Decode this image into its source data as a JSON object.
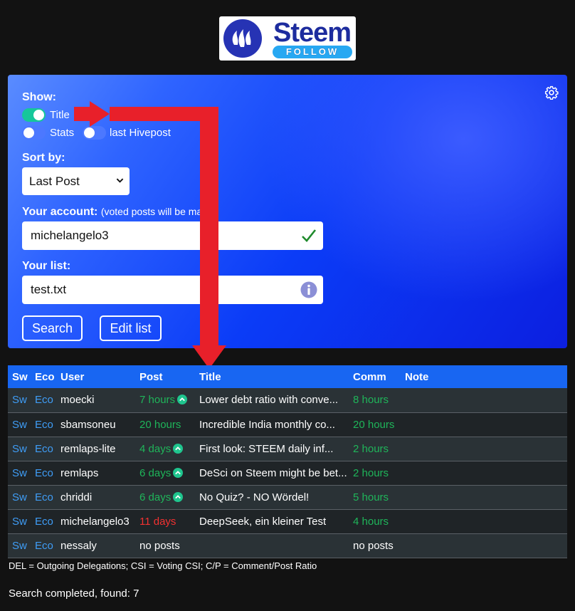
{
  "logo": {
    "word": "Steem",
    "sub": "FOLLOW"
  },
  "show": {
    "label": "Show:",
    "options": [
      {
        "label": "Title",
        "on": true
      },
      {
        "label": "Stats",
        "on": false
      },
      {
        "label": "last Hivepost",
        "on": false
      }
    ]
  },
  "sort": {
    "label": "Sort by:",
    "value": "Last Post"
  },
  "account": {
    "label": "Your account:",
    "note": "(voted posts will be mark",
    "value": "michelangelo3"
  },
  "list": {
    "label": "Your list:",
    "value": "test.txt"
  },
  "buttons": {
    "search": "Search",
    "edit": "Edit list"
  },
  "table": {
    "headers": [
      "Sw",
      "Eco",
      "User",
      "Post",
      "Title",
      "Comm",
      "Note"
    ],
    "rows": [
      {
        "sw": "Sw",
        "eco": "Eco",
        "user": "moecki",
        "post": "7 hours",
        "post_color": "green",
        "voted": true,
        "title": "Lower debt ratio with conve...",
        "comm": "8 hours",
        "note": ""
      },
      {
        "sw": "Sw",
        "eco": "Eco",
        "user": "sbamsoneu",
        "post": "20 hours",
        "post_color": "green",
        "voted": false,
        "title": "Incredible India monthly co...",
        "comm": "20 hours",
        "note": ""
      },
      {
        "sw": "Sw",
        "eco": "Eco",
        "user": "remlaps-lite",
        "post": "4 days",
        "post_color": "green",
        "voted": true,
        "title": "First look: STEEM daily inf...",
        "comm": "2 hours",
        "note": ""
      },
      {
        "sw": "Sw",
        "eco": "Eco",
        "user": "remlaps",
        "post": "6 days",
        "post_color": "green",
        "voted": true,
        "title": "DeSci on Steem might be bet...",
        "comm": "2 hours",
        "note": ""
      },
      {
        "sw": "Sw",
        "eco": "Eco",
        "user": "chriddi",
        "post": "6 days",
        "post_color": "green",
        "voted": true,
        "title": "No Quiz? - NO Wördel!",
        "comm": "5 hours",
        "note": ""
      },
      {
        "sw": "Sw",
        "eco": "Eco",
        "user": "michelangelo3",
        "post": "11 days",
        "post_color": "red",
        "voted": false,
        "title": "DeepSeek, ein kleiner Test",
        "comm": "4 hours",
        "note": ""
      },
      {
        "sw": "Sw",
        "eco": "Eco",
        "user": "nessaly",
        "post": "no posts",
        "post_color": "white",
        "voted": false,
        "title": "",
        "comm": "no posts",
        "note": ""
      }
    ]
  },
  "legend": "DEL = Outgoing Delegations; CSI = Voting CSI; C/P = Comment/Post Ratio",
  "status": "Search completed, found: 7",
  "colors": {
    "accent": "#1866f2",
    "toggle_on": "#16c79a",
    "recent": "#1fb55a",
    "old": "#f23131",
    "link": "#3f9df6",
    "annotation": "#e8202a"
  }
}
